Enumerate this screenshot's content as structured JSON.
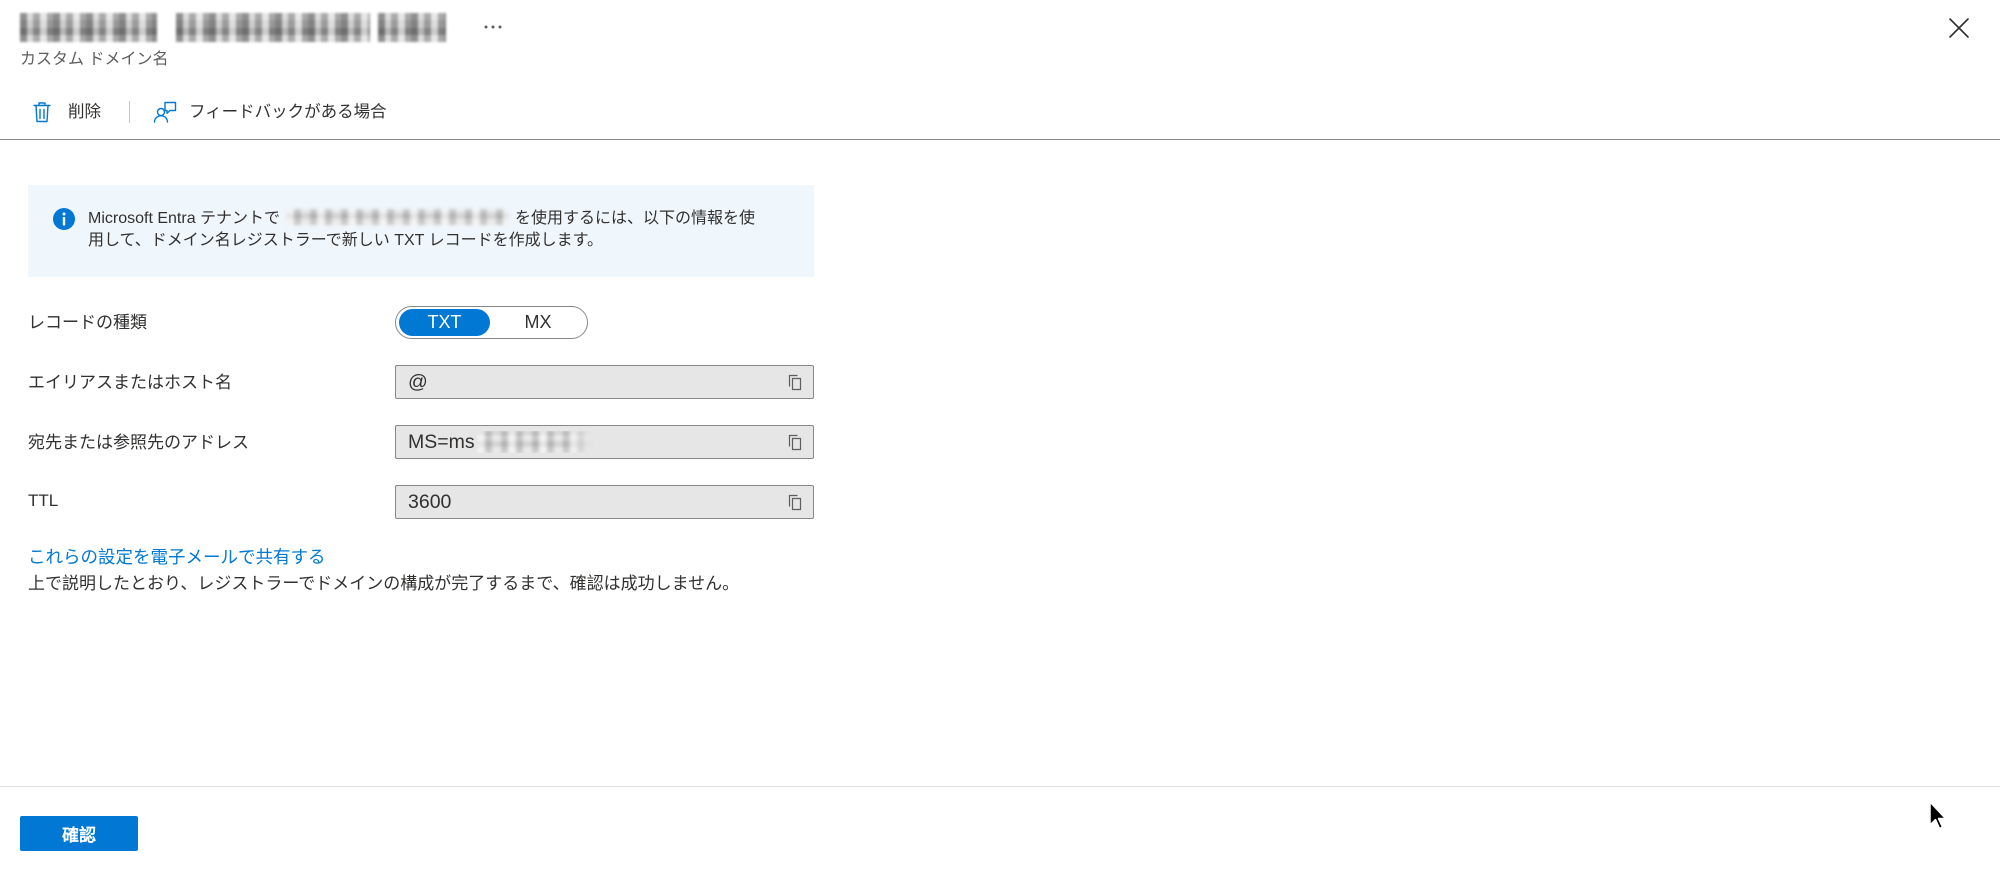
{
  "header": {
    "subtitle": "カスタム ドメイン名",
    "more_icon": "more-icon",
    "close_icon": "close-icon"
  },
  "toolbar": {
    "delete": {
      "icon": "trash-icon",
      "label": "削除"
    },
    "feedback": {
      "icon": "feedback-icon",
      "label": "フィードバックがある場合"
    }
  },
  "info": {
    "icon": "info-icon",
    "line1_prefix": "Microsoft Entra テナントで",
    "line1_suffix": "を使用するには、以下の情報を使",
    "line2": "用して、ドメイン名レジストラーで新しい TXT レコードを作成します。"
  },
  "form": {
    "record_type": {
      "label": "レコードの種類",
      "options": [
        {
          "label": "TXT",
          "selected": true
        },
        {
          "label": "MX",
          "selected": false
        }
      ]
    },
    "alias": {
      "label": "エイリアスまたはホスト名",
      "value": "@",
      "copy_icon": "copy-icon"
    },
    "destination": {
      "label": "宛先または参照先のアドレス",
      "value": "MS=ms",
      "copy_icon": "copy-icon"
    },
    "ttl": {
      "label": "TTL",
      "value": "3600",
      "copy_icon": "copy-icon"
    }
  },
  "share_link": {
    "label": "これらの設定を電子メールで共有する"
  },
  "note": {
    "text": "上で説明したとおり、レジストラーでドメインの構成が完了するまで、確認は成功しません。"
  },
  "footer": {
    "verify_label": "確認"
  },
  "cursor_icon": "mouse-cursor-icon",
  "colors": {
    "accent": "#0078d4",
    "text": "#323130",
    "subtext": "#605e5c",
    "info_background": "#eff6fc",
    "field_background": "#e6e6e6",
    "field_border": "#8a8886",
    "divider": "#8a8886"
  }
}
